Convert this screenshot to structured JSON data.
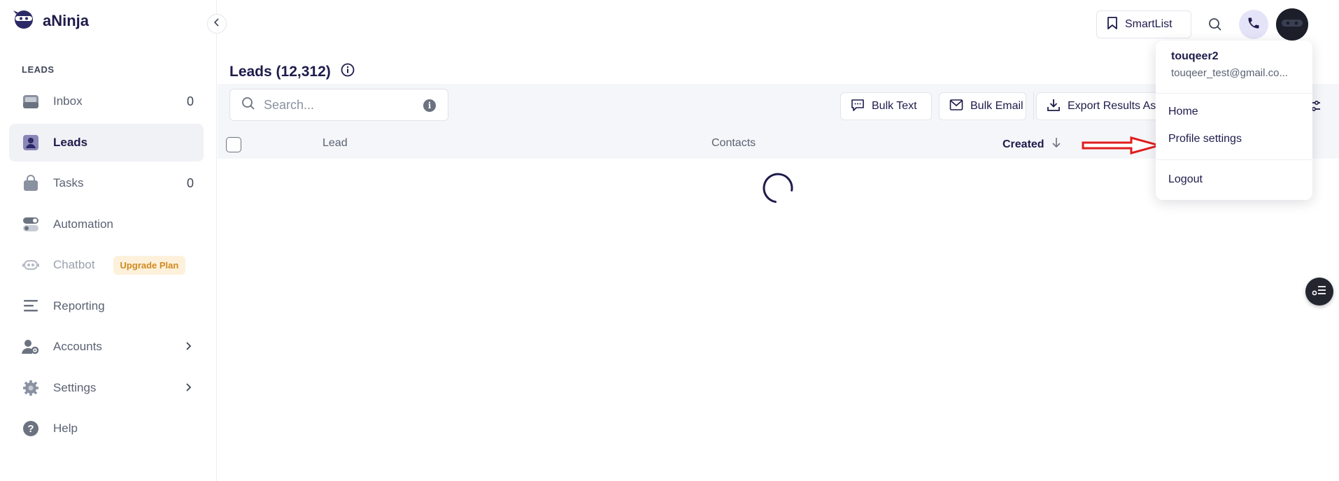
{
  "app": {
    "name": "aNinja"
  },
  "sidebar": {
    "section_label": "LEADS",
    "items": [
      {
        "label": "Inbox",
        "count": "0",
        "icon": "inbox-icon"
      },
      {
        "label": "Leads",
        "icon": "leads-icon",
        "active": true
      },
      {
        "label": "Tasks",
        "count": "0",
        "icon": "tasks-icon"
      },
      {
        "label": "Automation",
        "icon": "automation-icon"
      },
      {
        "label": "Chatbot",
        "badge": "Upgrade Plan",
        "icon": "chatbot-icon",
        "disabled": true
      },
      {
        "label": "Reporting",
        "icon": "reporting-icon"
      },
      {
        "label": "Accounts",
        "icon": "accounts-icon",
        "has_submenu": true
      },
      {
        "label": "Settings",
        "icon": "settings-icon",
        "has_submenu": true
      },
      {
        "label": "Help",
        "icon": "help-icon"
      }
    ]
  },
  "header": {
    "smartlist_label": "SmartList"
  },
  "main": {
    "title": "Leads (12,312)",
    "search": {
      "placeholder": "Search..."
    },
    "actions": {
      "bulk_text": "Bulk Text",
      "bulk_email": "Bulk Email",
      "export": "Export Results As"
    },
    "table": {
      "columns": [
        "Lead",
        "Contacts",
        "Created"
      ]
    }
  },
  "user_menu": {
    "username": "touqeer2",
    "email": "touqeer_test@gmail.co...",
    "items": [
      "Home",
      "Profile settings",
      "Logout"
    ]
  },
  "colors": {
    "brand": "#1e1b4b",
    "annotation_arrow": "#e11d1d",
    "upgrade_badge_bg": "#fdf1dc",
    "upgrade_badge_text": "#d18a1e"
  }
}
